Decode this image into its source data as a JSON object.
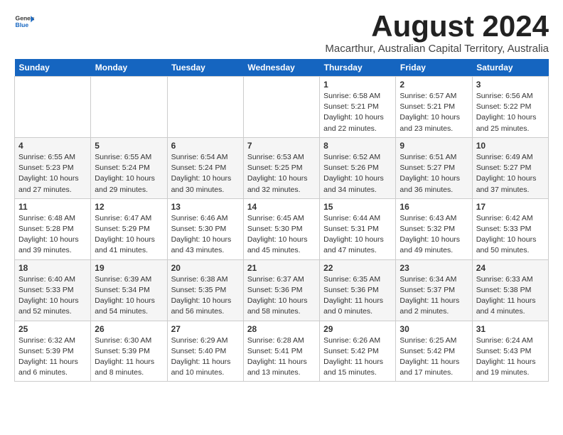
{
  "logo": {
    "line1": "General",
    "line2": "Blue"
  },
  "title": "August 2024",
  "subtitle": "Macarthur, Australian Capital Territory, Australia",
  "days_of_week": [
    "Sunday",
    "Monday",
    "Tuesday",
    "Wednesday",
    "Thursday",
    "Friday",
    "Saturday"
  ],
  "weeks": [
    [
      {
        "day": "",
        "info": ""
      },
      {
        "day": "",
        "info": ""
      },
      {
        "day": "",
        "info": ""
      },
      {
        "day": "",
        "info": ""
      },
      {
        "day": "1",
        "info": "Sunrise: 6:58 AM\nSunset: 5:21 PM\nDaylight: 10 hours\nand 22 minutes."
      },
      {
        "day": "2",
        "info": "Sunrise: 6:57 AM\nSunset: 5:21 PM\nDaylight: 10 hours\nand 23 minutes."
      },
      {
        "day": "3",
        "info": "Sunrise: 6:56 AM\nSunset: 5:22 PM\nDaylight: 10 hours\nand 25 minutes."
      }
    ],
    [
      {
        "day": "4",
        "info": "Sunrise: 6:55 AM\nSunset: 5:23 PM\nDaylight: 10 hours\nand 27 minutes."
      },
      {
        "day": "5",
        "info": "Sunrise: 6:55 AM\nSunset: 5:24 PM\nDaylight: 10 hours\nand 29 minutes."
      },
      {
        "day": "6",
        "info": "Sunrise: 6:54 AM\nSunset: 5:24 PM\nDaylight: 10 hours\nand 30 minutes."
      },
      {
        "day": "7",
        "info": "Sunrise: 6:53 AM\nSunset: 5:25 PM\nDaylight: 10 hours\nand 32 minutes."
      },
      {
        "day": "8",
        "info": "Sunrise: 6:52 AM\nSunset: 5:26 PM\nDaylight: 10 hours\nand 34 minutes."
      },
      {
        "day": "9",
        "info": "Sunrise: 6:51 AM\nSunset: 5:27 PM\nDaylight: 10 hours\nand 36 minutes."
      },
      {
        "day": "10",
        "info": "Sunrise: 6:49 AM\nSunset: 5:27 PM\nDaylight: 10 hours\nand 37 minutes."
      }
    ],
    [
      {
        "day": "11",
        "info": "Sunrise: 6:48 AM\nSunset: 5:28 PM\nDaylight: 10 hours\nand 39 minutes."
      },
      {
        "day": "12",
        "info": "Sunrise: 6:47 AM\nSunset: 5:29 PM\nDaylight: 10 hours\nand 41 minutes."
      },
      {
        "day": "13",
        "info": "Sunrise: 6:46 AM\nSunset: 5:30 PM\nDaylight: 10 hours\nand 43 minutes."
      },
      {
        "day": "14",
        "info": "Sunrise: 6:45 AM\nSunset: 5:30 PM\nDaylight: 10 hours\nand 45 minutes."
      },
      {
        "day": "15",
        "info": "Sunrise: 6:44 AM\nSunset: 5:31 PM\nDaylight: 10 hours\nand 47 minutes."
      },
      {
        "day": "16",
        "info": "Sunrise: 6:43 AM\nSunset: 5:32 PM\nDaylight: 10 hours\nand 49 minutes."
      },
      {
        "day": "17",
        "info": "Sunrise: 6:42 AM\nSunset: 5:33 PM\nDaylight: 10 hours\nand 50 minutes."
      }
    ],
    [
      {
        "day": "18",
        "info": "Sunrise: 6:40 AM\nSunset: 5:33 PM\nDaylight: 10 hours\nand 52 minutes."
      },
      {
        "day": "19",
        "info": "Sunrise: 6:39 AM\nSunset: 5:34 PM\nDaylight: 10 hours\nand 54 minutes."
      },
      {
        "day": "20",
        "info": "Sunrise: 6:38 AM\nSunset: 5:35 PM\nDaylight: 10 hours\nand 56 minutes."
      },
      {
        "day": "21",
        "info": "Sunrise: 6:37 AM\nSunset: 5:36 PM\nDaylight: 10 hours\nand 58 minutes."
      },
      {
        "day": "22",
        "info": "Sunrise: 6:35 AM\nSunset: 5:36 PM\nDaylight: 11 hours\nand 0 minutes."
      },
      {
        "day": "23",
        "info": "Sunrise: 6:34 AM\nSunset: 5:37 PM\nDaylight: 11 hours\nand 2 minutes."
      },
      {
        "day": "24",
        "info": "Sunrise: 6:33 AM\nSunset: 5:38 PM\nDaylight: 11 hours\nand 4 minutes."
      }
    ],
    [
      {
        "day": "25",
        "info": "Sunrise: 6:32 AM\nSunset: 5:39 PM\nDaylight: 11 hours\nand 6 minutes."
      },
      {
        "day": "26",
        "info": "Sunrise: 6:30 AM\nSunset: 5:39 PM\nDaylight: 11 hours\nand 8 minutes."
      },
      {
        "day": "27",
        "info": "Sunrise: 6:29 AM\nSunset: 5:40 PM\nDaylight: 11 hours\nand 10 minutes."
      },
      {
        "day": "28",
        "info": "Sunrise: 6:28 AM\nSunset: 5:41 PM\nDaylight: 11 hours\nand 13 minutes."
      },
      {
        "day": "29",
        "info": "Sunrise: 6:26 AM\nSunset: 5:42 PM\nDaylight: 11 hours\nand 15 minutes."
      },
      {
        "day": "30",
        "info": "Sunrise: 6:25 AM\nSunset: 5:42 PM\nDaylight: 11 hours\nand 17 minutes."
      },
      {
        "day": "31",
        "info": "Sunrise: 6:24 AM\nSunset: 5:43 PM\nDaylight: 11 hours\nand 19 minutes."
      }
    ]
  ]
}
